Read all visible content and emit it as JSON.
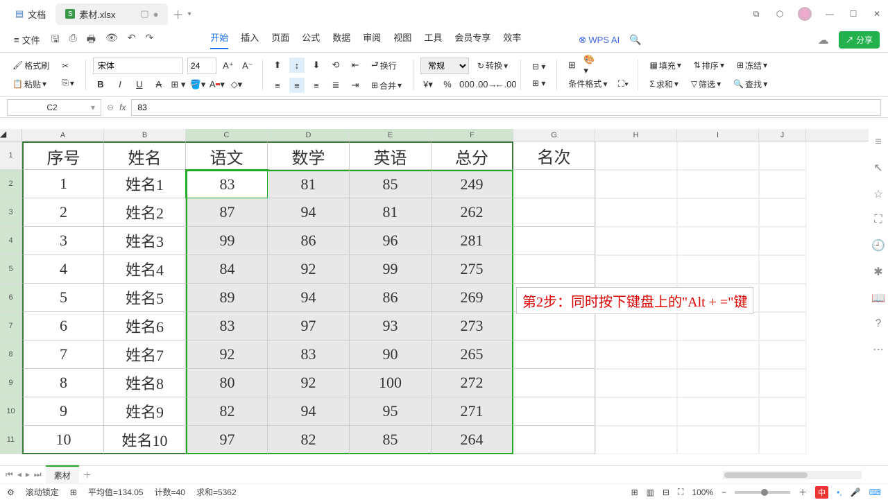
{
  "tabs": {
    "doc": "文档",
    "sheet": "素材.xlsx"
  },
  "file_menu": "文件",
  "menus": [
    "开始",
    "插入",
    "页面",
    "公式",
    "数据",
    "审阅",
    "视图",
    "工具",
    "会员专享",
    "效率"
  ],
  "wpsai": "WPS AI",
  "share": "分享",
  "ribbon": {
    "format_painter": "格式刷",
    "paste": "粘贴",
    "font": "宋体",
    "size": "24",
    "normal": "常规",
    "convert": "转换",
    "cond": "条件格式",
    "wrap": "换行",
    "merge": "合并",
    "fill": "填充",
    "sort": "排序",
    "freeze": "冻结",
    "sum": "求和",
    "filter": "筛选",
    "find": "查找"
  },
  "namebox": "C2",
  "formula": "83",
  "cols": [
    "A",
    "B",
    "C",
    "D",
    "E",
    "F",
    "G",
    "H",
    "I",
    "J"
  ],
  "headers": [
    "序号",
    "姓名",
    "语文",
    "数学",
    "英语",
    "总分",
    "名次"
  ],
  "rows": [
    {
      "n": "1",
      "name": "姓名1",
      "c": "83",
      "d": "81",
      "e": "85",
      "f": "249"
    },
    {
      "n": "2",
      "name": "姓名2",
      "c": "87",
      "d": "94",
      "e": "81",
      "f": "262"
    },
    {
      "n": "3",
      "name": "姓名3",
      "c": "99",
      "d": "86",
      "e": "96",
      "f": "281"
    },
    {
      "n": "4",
      "name": "姓名4",
      "c": "84",
      "d": "92",
      "e": "99",
      "f": "275"
    },
    {
      "n": "5",
      "name": "姓名5",
      "c": "89",
      "d": "94",
      "e": "86",
      "f": "269"
    },
    {
      "n": "6",
      "name": "姓名6",
      "c": "83",
      "d": "97",
      "e": "93",
      "f": "273"
    },
    {
      "n": "7",
      "name": "姓名7",
      "c": "92",
      "d": "83",
      "e": "90",
      "f": "265"
    },
    {
      "n": "8",
      "name": "姓名8",
      "c": "80",
      "d": "92",
      "e": "100",
      "f": "272"
    },
    {
      "n": "9",
      "name": "姓名9",
      "c": "82",
      "d": "94",
      "e": "95",
      "f": "271"
    },
    {
      "n": "10",
      "name": "姓名10",
      "c": "97",
      "d": "82",
      "e": "85",
      "f": "264"
    }
  ],
  "annotation": "第2步：同时按下键盘上的\"Alt + =\"键",
  "sheet_tab": "素材",
  "status": {
    "scroll_lock": "滚动锁定",
    "avg_label": "平均值=",
    "avg": "134.05",
    "count_label": "计数=",
    "count": "40",
    "sum_label": "求和=",
    "sum": "5362",
    "zoom": "100%",
    "ime": "中"
  },
  "chart_data": {
    "type": "table",
    "title": "",
    "columns": [
      "序号",
      "姓名",
      "语文",
      "数学",
      "英语",
      "总分",
      "名次"
    ],
    "data": [
      [
        1,
        "姓名1",
        83,
        81,
        85,
        249,
        null
      ],
      [
        2,
        "姓名2",
        87,
        94,
        81,
        262,
        null
      ],
      [
        3,
        "姓名3",
        99,
        86,
        96,
        281,
        null
      ],
      [
        4,
        "姓名4",
        84,
        92,
        99,
        275,
        null
      ],
      [
        5,
        "姓名5",
        89,
        94,
        86,
        269,
        null
      ],
      [
        6,
        "姓名6",
        83,
        97,
        93,
        273,
        null
      ],
      [
        7,
        "姓名7",
        92,
        83,
        90,
        265,
        null
      ],
      [
        8,
        "姓名8",
        80,
        92,
        100,
        272,
        null
      ],
      [
        9,
        "姓名9",
        82,
        94,
        95,
        271,
        null
      ],
      [
        10,
        "姓名10",
        97,
        82,
        85,
        264,
        null
      ]
    ]
  }
}
